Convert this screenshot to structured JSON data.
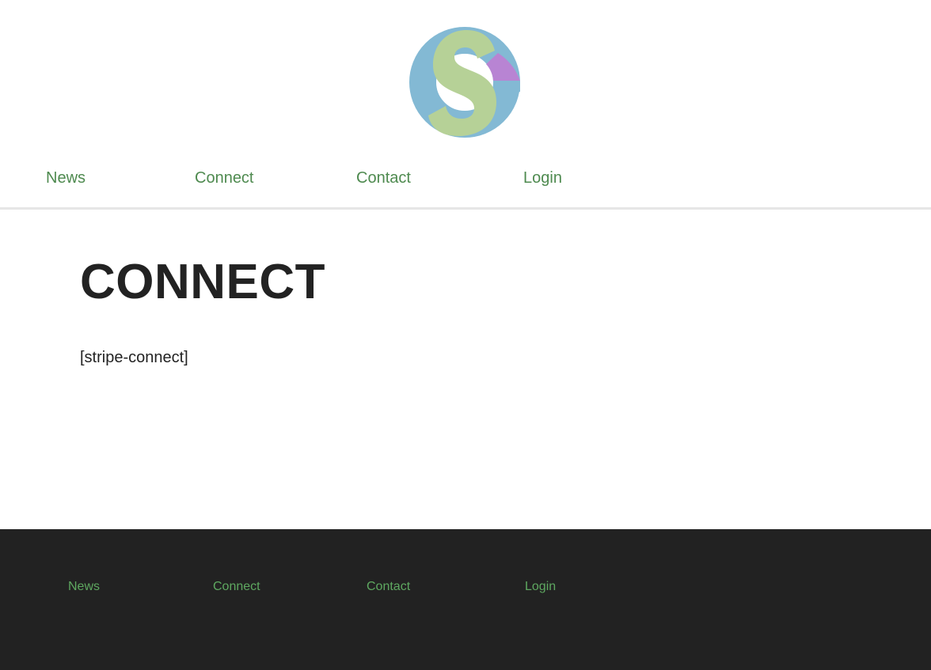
{
  "header": {
    "logo": {
      "icon": "sg-monogram-logo",
      "colors": {
        "ring": "#83b9d4",
        "letter": "#b6d197",
        "accent": "#b884d3"
      }
    },
    "nav": [
      {
        "label": "News"
      },
      {
        "label": "Connect"
      },
      {
        "label": "Contact"
      },
      {
        "label": "Login"
      }
    ]
  },
  "main": {
    "title": "CONNECT",
    "content": "[stripe-connect]"
  },
  "footer": {
    "nav": [
      {
        "label": "News"
      },
      {
        "label": "Connect"
      },
      {
        "label": "Contact"
      },
      {
        "label": "Login"
      }
    ]
  },
  "colors": {
    "link": "#4e8a4f",
    "footer_link": "#5ea860",
    "footer_background": "#222222",
    "text": "#222222"
  }
}
